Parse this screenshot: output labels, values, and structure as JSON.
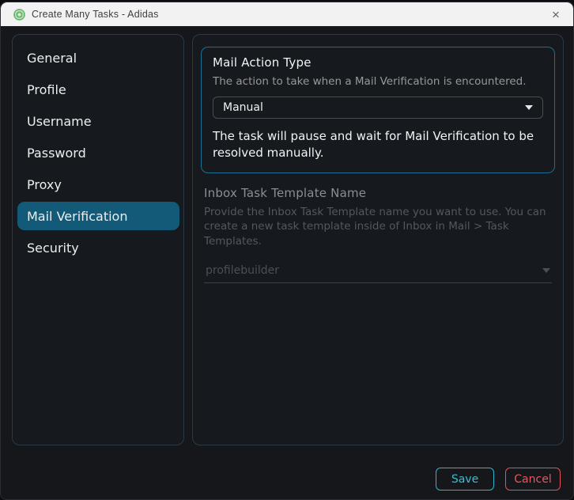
{
  "window": {
    "title": "Create Many Tasks - Adidas",
    "close_glyph": "×"
  },
  "icons": {
    "app": "green-logo-icon",
    "close": "close-icon",
    "dropdown": "chevron-down-icon"
  },
  "sidebar": {
    "items": [
      {
        "label": "General",
        "selected": false
      },
      {
        "label": "Profile",
        "selected": false
      },
      {
        "label": "Username",
        "selected": false
      },
      {
        "label": "Password",
        "selected": false
      },
      {
        "label": "Proxy",
        "selected": false
      },
      {
        "label": "Mail Verification",
        "selected": true
      },
      {
        "label": "Security",
        "selected": false
      }
    ]
  },
  "main": {
    "mail_action": {
      "title": "Mail Action Type",
      "description": "The action to take when a Mail Verification is encountered.",
      "selected_value": "Manual",
      "note": "The task will pause and wait for Mail Verification to be resolved manually."
    },
    "inbox_template": {
      "title": "Inbox Task Template Name",
      "description": "Provide the Inbox Task Template name you want to use. You can create a new task template inside of Inbox in Mail > Task Templates.",
      "selected_value": "profilebuilder",
      "disabled": true
    }
  },
  "footer": {
    "save_label": "Save",
    "cancel_label": "Cancel"
  },
  "colors": {
    "titlebar_bg": "#f2f2f2",
    "window_bg": "#15171b",
    "panel_border": "#2b3b45",
    "section_border": "#1e6e93",
    "selected_item_bg": "#135a78",
    "accent": "#2db6ca",
    "danger": "#e25059"
  }
}
